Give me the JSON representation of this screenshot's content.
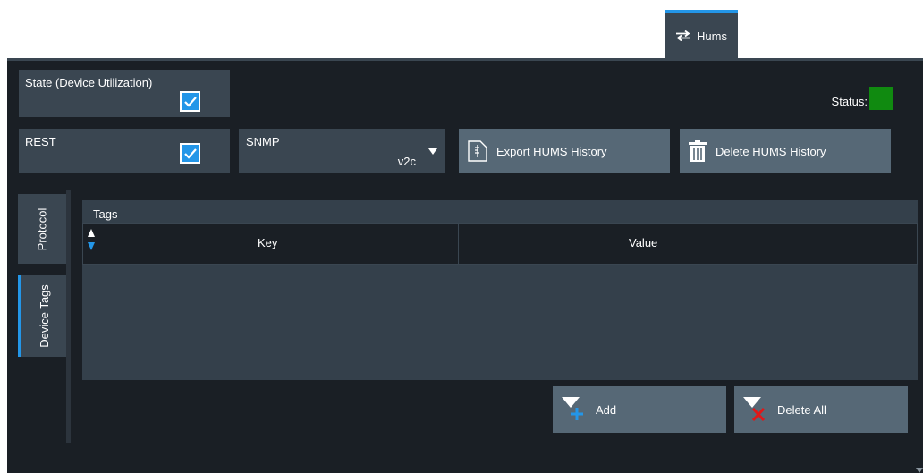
{
  "top_tab": {
    "label": "Hums",
    "icon": "swap-arrows-icon"
  },
  "state": {
    "label": "State (Device Utilization)",
    "checked": true
  },
  "rest": {
    "label": "REST",
    "checked": true
  },
  "status": {
    "label": "Status:",
    "color": "#108a10"
  },
  "snmp": {
    "label": "SNMP",
    "value": "v2c"
  },
  "buttons": {
    "export": "Export HUMS History",
    "delete_history": "Delete HUMS History",
    "add": "Add",
    "delete_all": "Delete All"
  },
  "side_tabs": [
    {
      "label": "Protocol",
      "active": false
    },
    {
      "label": "Device Tags",
      "active": true
    }
  ],
  "tags": {
    "title": "Tags",
    "columns": [
      "Key",
      "Value"
    ],
    "rows": []
  },
  "colors": {
    "accent": "#2396e8",
    "panel": "#3a4651",
    "background": "#1a1f25"
  }
}
